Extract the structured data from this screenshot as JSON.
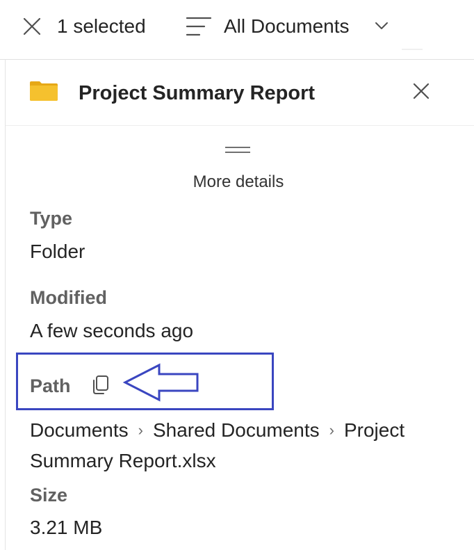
{
  "topbar": {
    "selected_text": "1 selected",
    "view_label": "All Documents",
    "icons": [
      "close-icon",
      "list-view-icon",
      "chevron-down-icon"
    ]
  },
  "panel": {
    "title": "Project Summary Report",
    "item_icon": "folder-icon",
    "more_details": "More details",
    "properties": {
      "type": {
        "label": "Type",
        "value": "Folder"
      },
      "modified": {
        "label": "Modified",
        "value": "A few seconds ago"
      },
      "path": {
        "label": "Path",
        "copy_icon": "copy-icon",
        "breadcrumb": [
          "Documents",
          "Shared Documents",
          "Project Summary Report.xlsx"
        ],
        "separator": "›"
      },
      "size": {
        "label": "Size",
        "value": "3.21 MB"
      }
    }
  },
  "annotation": {
    "box_color": "#3a46c0",
    "arrow_color": "#3a46c0"
  },
  "colors": {
    "folder": "#f5c12e",
    "folder_dark": "#e6a817",
    "label_gray": "#616161",
    "text": "#242424"
  }
}
